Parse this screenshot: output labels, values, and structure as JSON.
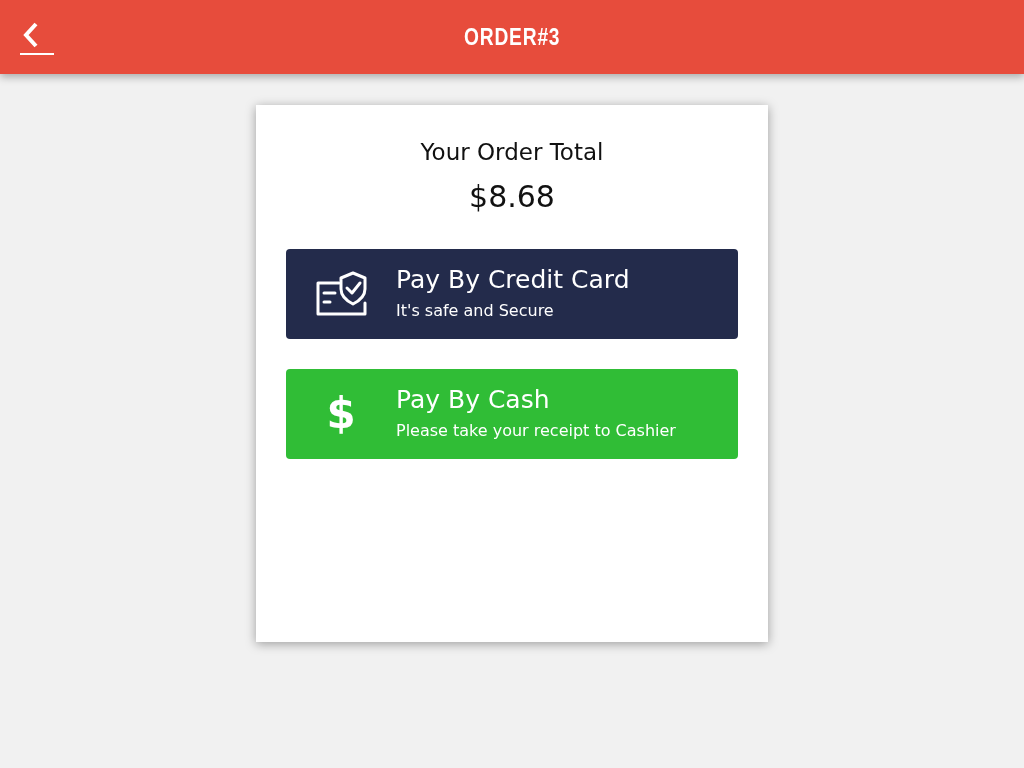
{
  "header": {
    "title": "ORDER#3"
  },
  "summary": {
    "label": "Your Order Total",
    "total": "$8.68"
  },
  "payment_options": [
    {
      "kind": "card",
      "color": "#232b4b",
      "title": "Pay By Credit Card",
      "subtitle": "It's safe and Secure"
    },
    {
      "kind": "cash",
      "color": "#30bd36",
      "icon_glyph": "$",
      "title": "Pay By Cash",
      "subtitle": "Please take your receipt to Cashier"
    }
  ]
}
